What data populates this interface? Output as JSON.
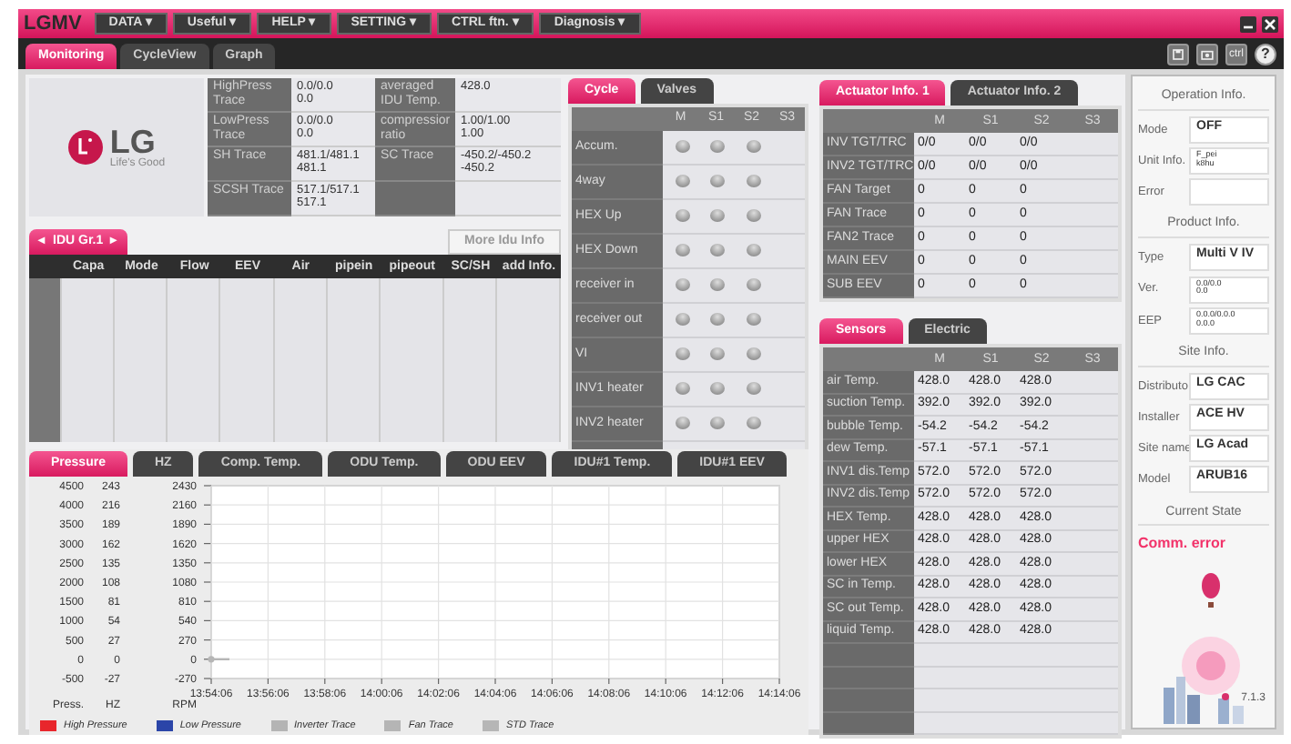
{
  "app": {
    "name": "LGMV"
  },
  "menu": [
    "DATA ▾",
    "Useful ▾",
    "HELP ▾",
    "SETTING ▾",
    "CTRL ftn. ▾",
    "Diagnosis ▾"
  ],
  "main_tabs": [
    {
      "label": "Monitoring",
      "selected": true
    },
    {
      "label": "CycleView",
      "selected": false
    },
    {
      "label": "Graph",
      "selected": false
    }
  ],
  "toolbar_labels": [
    "ctrl",
    "?"
  ],
  "logo": {
    "mark": "LG",
    "slogan": "Life's Good"
  },
  "info_table": {
    "left": [
      {
        "label": "HighPress Trace",
        "value": "0.0/0.0\n0.0"
      },
      {
        "label": "LowPress Trace",
        "value": "0.0/0.0\n0.0"
      },
      {
        "label": "SH Trace",
        "value": "481.1/481.1\n481.1"
      },
      {
        "label": "SCSH Trace",
        "value": "517.1/517.1\n517.1"
      }
    ],
    "right": [
      {
        "label": "averaged IDU Temp.",
        "value": "428.0"
      },
      {
        "label": "compressior ratio",
        "value": "1.00/1.00\n1.00"
      },
      {
        "label": "SC Trace",
        "value": "-450.2/-450.2\n-450.2"
      }
    ]
  },
  "idu_group": {
    "prev": "◂",
    "label": "IDU Gr.1",
    "next": "▸",
    "more_button": {
      "label": "More Idu Info",
      "disabled": true
    },
    "columns": [
      "Capa",
      "Mode",
      "Flow",
      "EEV",
      "Air",
      "pipein",
      "pipeout",
      "SC/SH",
      "add Info."
    ]
  },
  "cycle_panel": {
    "tabs": [
      {
        "label": "Cycle",
        "selected": true
      },
      {
        "label": "Valves",
        "selected": false
      }
    ],
    "columns": [
      "M",
      "S1",
      "S2",
      "S3"
    ],
    "rows": [
      {
        "label": "Accum.",
        "leds": [
          false,
          false,
          false
        ]
      },
      {
        "label": "4way",
        "leds": [
          false,
          false,
          false
        ]
      },
      {
        "label": "HEX Up",
        "leds": [
          false,
          false,
          false
        ]
      },
      {
        "label": "HEX Down",
        "leds": [
          false,
          false,
          false
        ]
      },
      {
        "label": "receiver in",
        "leds": [
          false,
          false,
          false
        ]
      },
      {
        "label": "receiver out",
        "leds": [
          false,
          false,
          false
        ]
      },
      {
        "label": "VI",
        "leds": [
          false,
          false,
          false
        ]
      },
      {
        "label": "INV1 heater",
        "leds": [
          false,
          false,
          false
        ]
      },
      {
        "label": "INV2 heater",
        "leds": [
          false,
          false,
          false
        ]
      }
    ]
  },
  "actuator_panel": {
    "tabs": [
      {
        "label": "Actuator Info. 1",
        "selected": true
      },
      {
        "label": "Actuator Info. 2",
        "selected": false
      }
    ],
    "columns": [
      "M",
      "S1",
      "S2",
      "S3"
    ],
    "rows": [
      {
        "label": "INV TGT/TRC",
        "values": [
          "0/0",
          "0/0",
          "0/0"
        ]
      },
      {
        "label": "INV2 TGT/TRC",
        "values": [
          "0/0",
          "0/0",
          "0/0"
        ]
      },
      {
        "label": "FAN Target",
        "values": [
          "0",
          "0",
          "0"
        ]
      },
      {
        "label": "FAN Trace",
        "values": [
          "0",
          "0",
          "0"
        ]
      },
      {
        "label": "FAN2 Trace",
        "values": [
          "0",
          "0",
          "0"
        ]
      },
      {
        "label": "MAIN EEV",
        "values": [
          "0",
          "0",
          "0"
        ]
      },
      {
        "label": "SUB EEV",
        "values": [
          "0",
          "0",
          "0"
        ]
      }
    ]
  },
  "sensor_panel": {
    "tabs": [
      {
        "label": "Sensors",
        "selected": true
      },
      {
        "label": "Electric",
        "selected": false
      }
    ],
    "columns": [
      "M",
      "S1",
      "S2",
      "S3"
    ],
    "rows": [
      {
        "label": "air Temp.",
        "values": [
          "428.0",
          "428.0",
          "428.0"
        ]
      },
      {
        "label": "suction Temp.",
        "values": [
          "392.0",
          "392.0",
          "392.0"
        ]
      },
      {
        "label": "bubble Temp.",
        "values": [
          "-54.2",
          "-54.2",
          "-54.2"
        ]
      },
      {
        "label": "dew Temp.",
        "values": [
          "-57.1",
          "-57.1",
          "-57.1"
        ]
      },
      {
        "label": "INV1 dis.Temp",
        "values": [
          "572.0",
          "572.0",
          "572.0"
        ]
      },
      {
        "label": "INV2 dis.Temp",
        "values": [
          "572.0",
          "572.0",
          "572.0"
        ]
      },
      {
        "label": "HEX Temp.",
        "values": [
          "428.0",
          "428.0",
          "428.0"
        ]
      },
      {
        "label": "upper HEX",
        "values": [
          "428.0",
          "428.0",
          "428.0"
        ]
      },
      {
        "label": "lower HEX",
        "values": [
          "428.0",
          "428.0",
          "428.0"
        ]
      },
      {
        "label": "SC in Temp.",
        "values": [
          "428.0",
          "428.0",
          "428.0"
        ]
      },
      {
        "label": "SC out Temp.",
        "values": [
          "428.0",
          "428.0",
          "428.0"
        ]
      },
      {
        "label": "liquid Temp.",
        "values": [
          "428.0",
          "428.0",
          "428.0"
        ]
      }
    ]
  },
  "chart_panel": {
    "tabs": [
      {
        "label": "Pressure",
        "selected": true
      },
      {
        "label": "HZ",
        "selected": false
      },
      {
        "label": "Comp. Temp.",
        "selected": false
      },
      {
        "label": "ODU Temp.",
        "selected": false
      },
      {
        "label": "ODU EEV",
        "selected": false
      },
      {
        "label": "IDU#1 Temp.",
        "selected": false
      },
      {
        "label": "IDU#1 EEV",
        "selected": false
      }
    ],
    "secondary_axes": [
      {
        "label": "Press.",
        "ticks": [
          "4500",
          "4000",
          "3500",
          "3000",
          "2500",
          "2000",
          "1500",
          "1000",
          "500",
          "0",
          "-500"
        ]
      },
      {
        "label": "HZ",
        "ticks": [
          "243",
          "216",
          "189",
          "162",
          "135",
          "108",
          "81",
          "54",
          "27",
          "0",
          "-27"
        ]
      }
    ],
    "chart_data": {
      "type": "line",
      "grid": true,
      "ylabel": "RPM",
      "categories": [
        "13:54:06",
        "13:56:06",
        "13:58:06",
        "14:00:06",
        "14:02:06",
        "14:04:06",
        "14:06:06",
        "14:08:06",
        "14:10:06",
        "14:12:06",
        "14:14:06"
      ],
      "ylim": [
        -270,
        2430
      ],
      "yticks": [
        -270,
        0,
        270,
        540,
        810,
        1080,
        1350,
        1620,
        1890,
        2160,
        2430
      ],
      "series": [
        {
          "name": "High Pressure",
          "color": "#e8262c",
          "values": [
            null,
            null,
            null,
            null,
            null,
            null,
            null,
            null,
            null,
            null,
            null
          ]
        },
        {
          "name": "Low Pressure",
          "color": "#2b45a8",
          "values": [
            null,
            null,
            null,
            null,
            null,
            null,
            null,
            null,
            null,
            null,
            null
          ]
        },
        {
          "name": "Inverter Trace",
          "color": "#b4b4b4",
          "values": [
            null,
            null,
            null,
            null,
            null,
            null,
            null,
            null,
            null,
            null,
            null
          ]
        },
        {
          "name": "Fan Trace",
          "color": "#b5b5b5",
          "values": [
            null,
            null,
            null,
            null,
            null,
            null,
            null,
            null,
            null,
            null,
            null
          ]
        },
        {
          "name": "STD Trace",
          "color": "#b6b6b6",
          "marker": true,
          "values": [
            0,
            null,
            null,
            null,
            null,
            null,
            null,
            null,
            null,
            null,
            null
          ]
        }
      ]
    }
  },
  "sidebar": {
    "sections": [
      {
        "title": "Operation Info.",
        "fields": [
          {
            "label": "Mode",
            "value": "OFF",
            "kind": "text"
          },
          {
            "label": "Unit Info.",
            "value": "F_pei\nk8hu",
            "kind": "detail"
          },
          {
            "label": "Error",
            "kind": "text"
          }
        ]
      },
      {
        "title": "Product Info.",
        "fields": [
          {
            "label": "Type",
            "value": "Multi V IV",
            "kind": "text"
          },
          {
            "label": "Ver.",
            "value": "0.0/0.0\n0.0",
            "kind": "detail"
          },
          {
            "label": "EEP",
            "value": "0.0.0/0.0.0\n0.0.0",
            "kind": "detail"
          }
        ]
      },
      {
        "title": "Site Info.",
        "fields": [
          {
            "label": "Distributo",
            "value": "LG CAC",
            "kind": "text"
          },
          {
            "label": "Installer",
            "value": "ACE HV",
            "kind": "text"
          },
          {
            "label": "Site name",
            "value": "LG Acad",
            "kind": "text"
          },
          {
            "label": "Model",
            "value": "ARUB16",
            "kind": "text"
          }
        ]
      }
    ],
    "current_state": {
      "title": "Current State",
      "status": "Comm. error"
    },
    "version": "7.1.3"
  }
}
